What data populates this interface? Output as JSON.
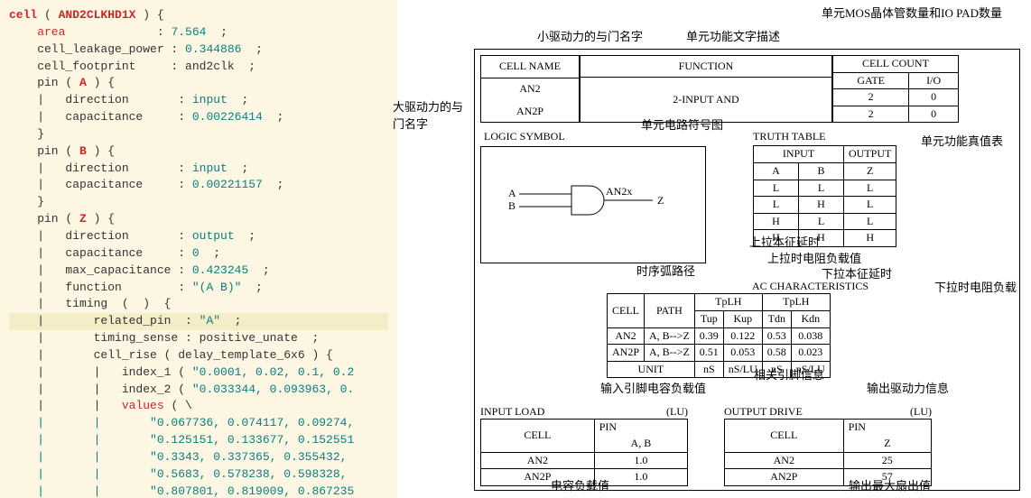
{
  "code": {
    "l1a": "cell",
    "l1b": " ( ",
    "l1c": "AND2CLKHD1X",
    "l1d": " ) {",
    "l2a": "    area",
    "l2b": "             : ",
    "l2c": "7.564",
    "l2d": "  ;",
    "l3a": "    cell_leakage_power : ",
    "l3b": "0.344886",
    "l3c": "  ;",
    "l4a": "    cell_footprint     : and2clk  ;",
    "l5a": "    pin ( ",
    "l5b": "A",
    "l5c": " ) {",
    "l6a": "    |   direction       : ",
    "l6b": "input",
    "l6c": "  ;",
    "l7a": "    |   capacitance     : ",
    "l7b": "0.00226414",
    "l7c": "  ;",
    "l8": "    }",
    "l9a": "    pin ( ",
    "l9b": "B",
    "l9c": " ) {",
    "l10a": "    |   direction       : ",
    "l10b": "input",
    "l10c": "  ;",
    "l11a": "    |   capacitance     : ",
    "l11b": "0.00221157",
    "l11c": "  ;",
    "l12": "    }",
    "l13a": "    pin ( ",
    "l13b": "Z",
    "l13c": " ) {",
    "l14a": "    |   direction       : ",
    "l14b": "output",
    "l14c": "  ;",
    "l15a": "    |   capacitance     : ",
    "l15b": "0",
    "l15c": "  ;",
    "l16a": "    |   max_capacitance : ",
    "l16b": "0.423245",
    "l16c": "  ;",
    "l17a": "    |   function        : ",
    "l17b": "\"(A B)\"",
    "l17c": "  ;",
    "l18": "    |   timing  (  )  {",
    "l19a": "    |       related_pin  : ",
    "l19b": "\"A\"",
    "l19c": "  ;",
    "l20": "    |       timing_sense : positive_unate  ;",
    "l21": "    |       cell_rise ( delay_template_6x6 ) {",
    "l22a": "    |       |   index_1 ( ",
    "l22b": "\"0.0001, 0.02, 0.1, 0.2",
    "l23a": "    |       |   index_2 ( ",
    "l23b": "\"0.033344, 0.093963, 0.",
    "l24a": "    |       |   ",
    "l24b": "values",
    "l24c": " ( \\",
    "l25": "    |       |       \"0.067736, 0.074117, 0.09274,",
    "l26": "    |       |       \"0.125151, 0.133677, 0.152551",
    "l27": "    |       |       \"0.3343, 0.337365, 0.355432, ",
    "l28": "    |       |       \"0.5683, 0.578238, 0.598328, ",
    "l29": "    |       |       \"0.807801, 0.819009, 0.867235"
  },
  "ann": {
    "a1": "小驱动力的与门名字",
    "a2": "单元功能文字描述",
    "a3": "单元MOS晶体管数量和IO PAD数量",
    "a4": "大驱动力的与门名字",
    "a5": "单元电路符号图",
    "a6": "单元功能真值表",
    "a7": "上拉本征延时",
    "a8": "时序弧路径",
    "a9": "上拉时电阻负载值",
    "a10": "下拉本征延时",
    "a11": "下拉时电阻负载",
    "a12": "输入引脚电容负载值",
    "a13": "相关引脚信息",
    "a14": "输出驱动力信息",
    "a15": "电容负载值",
    "a16": "输出最大扇出值"
  },
  "t1": {
    "h1": "CELL NAME",
    "h2": "FUNCTION",
    "h3": "CELL COUNT",
    "r1": "AN2",
    "r2": "AN2P",
    "func": "2-INPUT AND",
    "g": "GATE",
    "io": "I/O",
    "g1": "2",
    "io1": "0",
    "g2": "2",
    "io2": "0"
  },
  "logic": {
    "title": "LOGIC SYMBOL",
    "a": "A",
    "b": "B",
    "gate": "AN2x",
    "z": "Z"
  },
  "truth": {
    "title": "TRUTH TABLE",
    "in": "INPUT",
    "out": "OUTPUT",
    "a": "A",
    "b": "B",
    "z": "Z",
    "r": [
      [
        "L",
        "L",
        "L"
      ],
      [
        "L",
        "H",
        "L"
      ],
      [
        "H",
        "L",
        "L"
      ],
      [
        "H",
        "H",
        "H"
      ]
    ]
  },
  "ac": {
    "title": "AC CHARACTERISTICS",
    "cell": "CELL",
    "path": "PATH",
    "tplh": "TpLH",
    "tphl": "TpLH",
    "tup": "Tup",
    "kup": "Kup",
    "tdn": "Tdn",
    "kdn": "Kdn",
    "r1": [
      "AN2",
      "A, B-->Z",
      "0.39",
      "0.122",
      "0.53",
      "0.038"
    ],
    "r2": [
      "AN2P",
      "A, B-->Z",
      "0.51",
      "0.053",
      "0.58",
      "0.023"
    ],
    "unit": "UNIT",
    "u1": "nS",
    "u2": "nS/LU",
    "u3": "nS",
    "u4": "nS/LU"
  },
  "il": {
    "title": "INPUT LOAD",
    "lu": "(LU)",
    "cell": "CELL",
    "pin": "PIN",
    "ab": "A, B",
    "r1": [
      "AN2",
      "1.0"
    ],
    "r2": [
      "AN2P",
      "1.0"
    ]
  },
  "od": {
    "title": "OUTPUT DRIVE",
    "lu": "(LU)",
    "cell": "CELL",
    "pin": "PIN",
    "z": "Z",
    "r1": [
      "AN2",
      "25"
    ],
    "r2": [
      "AN2P",
      "57"
    ]
  }
}
